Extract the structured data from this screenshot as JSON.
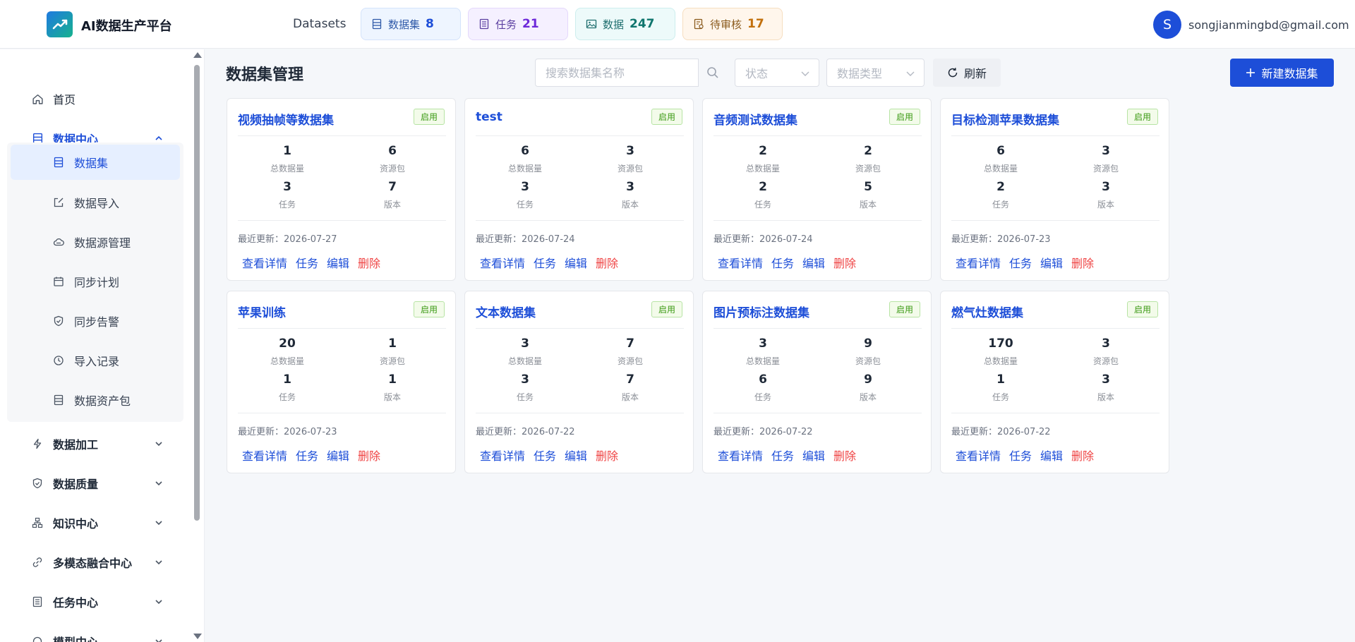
{
  "app": {
    "title": "AI数据生产平台",
    "datasets_label": "Datasets"
  },
  "header": {
    "pills": [
      {
        "label": "数据集",
        "value": "8",
        "icon": "dataset-icon"
      },
      {
        "label": "任务",
        "value": "21",
        "icon": "task-list-icon"
      },
      {
        "label": "数据",
        "value": "247",
        "icon": "image-icon"
      },
      {
        "label": "待审核",
        "value": "17",
        "icon": "review-icon"
      }
    ],
    "user": {
      "avatar_letter": "S",
      "email": "songjianmingbd@gmail.com"
    }
  },
  "sidebar": {
    "home": "首页",
    "data_center": "数据中心",
    "sub_items": [
      "数据集",
      "数据导入",
      "数据源管理",
      "同步计划",
      "同步告警",
      "导入记录",
      "数据资产包"
    ],
    "groups": [
      "数据加工",
      "数据质量",
      "知识中心",
      "多模态融合中心",
      "任务中心",
      "模型中心"
    ]
  },
  "main": {
    "title": "数据集管理",
    "search_placeholder": "搜索数据集名称",
    "status_placeholder": "状态",
    "type_placeholder": "数据类型",
    "refresh_label": "刷新",
    "new_label": "新建数据集"
  },
  "stat_labels": {
    "total": "总数据量",
    "packages": "资源包",
    "tasks": "任务",
    "versions": "版本"
  },
  "updated_prefix": "最近更新：",
  "action_labels": {
    "detail": "查看详情",
    "task": "任务",
    "edit": "编辑",
    "delete": "删除"
  },
  "cards": [
    {
      "name": "视频抽帧等数据集",
      "status": "启用",
      "total": "1",
      "packages": "6",
      "tasks": "3",
      "versions": "7",
      "updated": "2026-07-27"
    },
    {
      "name": "test",
      "status": "启用",
      "total": "6",
      "packages": "3",
      "tasks": "3",
      "versions": "3",
      "updated": "2026-07-24"
    },
    {
      "name": "音频测试数据集",
      "status": "启用",
      "total": "2",
      "packages": "2",
      "tasks": "2",
      "versions": "5",
      "updated": "2026-07-24"
    },
    {
      "name": "目标检测苹果数据集",
      "status": "启用",
      "total": "6",
      "packages": "3",
      "tasks": "2",
      "versions": "3",
      "updated": "2026-07-23"
    },
    {
      "name": "苹果训练",
      "status": "启用",
      "total": "20",
      "packages": "1",
      "tasks": "1",
      "versions": "1",
      "updated": "2026-07-23"
    },
    {
      "name": "文本数据集",
      "status": "启用",
      "total": "3",
      "packages": "7",
      "tasks": "3",
      "versions": "7",
      "updated": "2026-07-22"
    },
    {
      "name": "图片预标注数据集",
      "status": "启用",
      "total": "3",
      "packages": "9",
      "tasks": "6",
      "versions": "9",
      "updated": "2026-07-22"
    },
    {
      "name": "燃气灶数据集",
      "status": "启用",
      "total": "170",
      "packages": "3",
      "tasks": "1",
      "versions": "3",
      "updated": "2026-07-22"
    }
  ]
}
